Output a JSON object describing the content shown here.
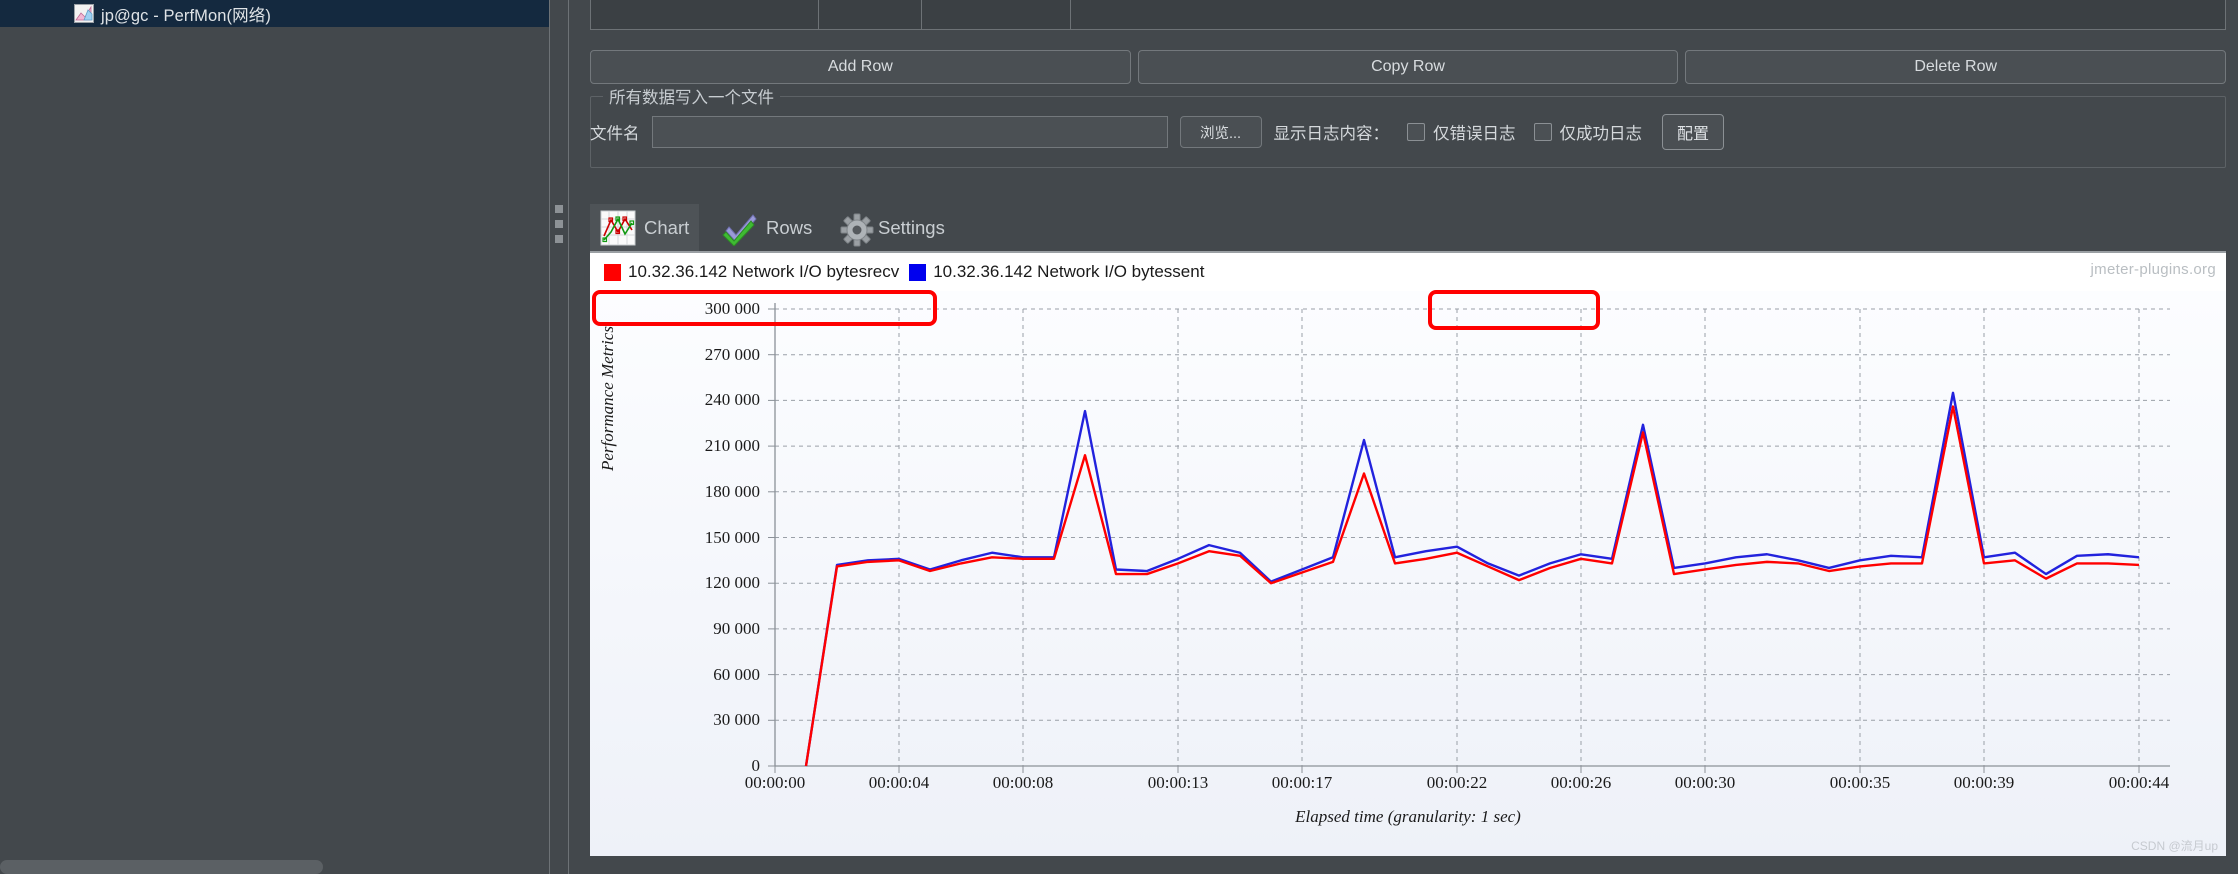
{
  "tree": {
    "selected_item": {
      "label": "jp@gc - PerfMon(网络)",
      "icon": "perfmon-chart-icon"
    }
  },
  "toolbar": {
    "add_row_label": "Add Row",
    "copy_row_label": "Copy Row",
    "delete_row_label": "Delete Row"
  },
  "write_group": {
    "title": "所有数据写入一个文件",
    "filename_label": "文件名",
    "filename_value": "",
    "filename_placeholder": "",
    "browse_label": "浏览...",
    "log_content_label": "显示日志内容：",
    "checkbox_errors_label": "仅错误日志",
    "checkbox_errors_checked": false,
    "checkbox_success_label": "仅成功日志",
    "checkbox_success_checked": false,
    "configure_label": "配置"
  },
  "tabs": [
    {
      "label": "Chart",
      "icon": "line-chart-icon",
      "selected": true
    },
    {
      "label": "Rows",
      "icon": "double-check-icon",
      "selected": false
    },
    {
      "label": "Settings",
      "icon": "gear-icon",
      "selected": false
    }
  ],
  "watermarks": {
    "jmeter": "jmeter-plugins.org",
    "csdn": "CSDN @流月up"
  },
  "colors": {
    "series_recv": "#ff0000",
    "series_sent": "#2222dd",
    "annotation": "#ff0000",
    "panel_bg": "#43484c",
    "selection_bg": "#14293f"
  },
  "annotations": [
    {
      "name": "legend-bytesrecv-highlight"
    },
    {
      "name": "legend-bytessent-highlight"
    }
  ],
  "chart_data": {
    "type": "line",
    "title": "",
    "xlabel": "Elapsed time (granularity: 1 sec)",
    "ylabel": "Performance Metrics",
    "ylim": [
      0,
      300000
    ],
    "ytick_labels": [
      "300 000",
      "270 000",
      "240 000",
      "210 000",
      "180 000",
      "150 000",
      "120 000",
      "90 000",
      "60 000",
      "30 000",
      "0"
    ],
    "ytick_values": [
      300000,
      270000,
      240000,
      210000,
      180000,
      150000,
      120000,
      90000,
      60000,
      30000,
      0
    ],
    "xtick_labels": [
      "00:00:00",
      "00:00:04",
      "00:00:08",
      "00:00:13",
      "00:00:17",
      "00:00:22",
      "00:00:26",
      "00:00:30",
      "00:00:35",
      "00:00:39",
      "00:00:44"
    ],
    "xtick_values": [
      0,
      4,
      8,
      13,
      17,
      22,
      26,
      30,
      35,
      39,
      44
    ],
    "xlim": [
      0,
      45
    ],
    "grid": true,
    "legend_position": "top-left",
    "series": [
      {
        "name": "10.32.36.142 Network I/O bytesrecv",
        "color": "#ff0000",
        "x": [
          1,
          2,
          3,
          4,
          5,
          6,
          7,
          8,
          9,
          10,
          11,
          12,
          13,
          14,
          15,
          16,
          17,
          18,
          19,
          20,
          21,
          22,
          23,
          24,
          25,
          26,
          27,
          28,
          29,
          30,
          31,
          32,
          33,
          34,
          35,
          36,
          37,
          38,
          39,
          40,
          41,
          42,
          43,
          44
        ],
        "values": [
          0,
          131000,
          134000,
          135000,
          128000,
          133000,
          137000,
          136000,
          136000,
          204000,
          126000,
          126000,
          133000,
          141000,
          138000,
          120000,
          127000,
          134000,
          192000,
          133000,
          136000,
          140000,
          131000,
          122000,
          130000,
          136000,
          133000,
          219000,
          126000,
          129000,
          132000,
          134000,
          133000,
          128000,
          131000,
          133000,
          133000,
          236000,
          133000,
          135000,
          123000,
          133000,
          133000,
          132000
        ]
      },
      {
        "name": "10.32.36.142 Network I/O bytessent",
        "color": "#2222dd",
        "x": [
          1,
          2,
          3,
          4,
          5,
          6,
          7,
          8,
          9,
          10,
          11,
          12,
          13,
          14,
          15,
          16,
          17,
          18,
          19,
          20,
          21,
          22,
          23,
          24,
          25,
          26,
          27,
          28,
          29,
          30,
          31,
          32,
          33,
          34,
          35,
          36,
          37,
          38,
          39,
          40,
          41,
          42,
          43,
          44
        ],
        "values": [
          0,
          132000,
          135000,
          136000,
          129000,
          135000,
          140000,
          137000,
          137000,
          233000,
          129000,
          128000,
          136000,
          145000,
          140000,
          121000,
          129000,
          137000,
          214000,
          137000,
          141000,
          144000,
          133000,
          125000,
          133000,
          139000,
          136000,
          224000,
          130000,
          133000,
          137000,
          139000,
          135000,
          130000,
          135000,
          138000,
          137000,
          245000,
          137000,
          140000,
          126000,
          138000,
          139000,
          137000
        ]
      }
    ]
  }
}
